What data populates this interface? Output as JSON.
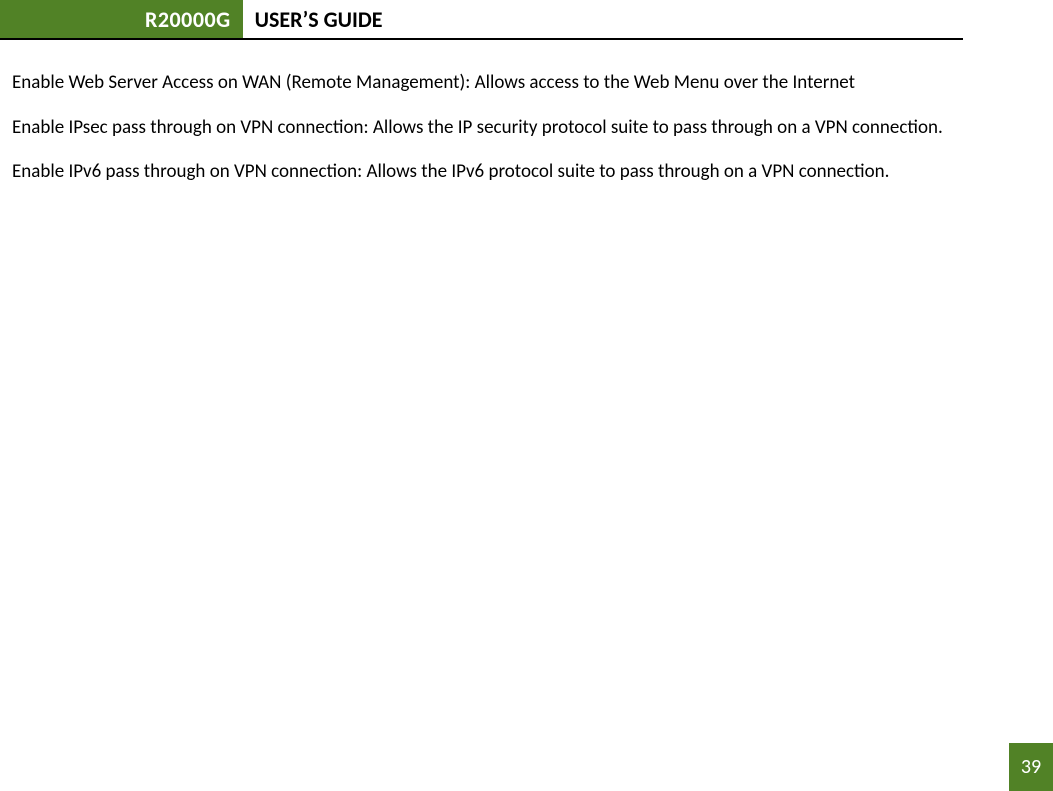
{
  "header": {
    "badge": "R20000G",
    "title": "USER’S GUIDE"
  },
  "content": {
    "paragraphs": [
      "Enable Web Server Access on WAN (Remote Management): Allows access to the Web Menu over the Internet",
      "Enable IPsec pass through on VPN connection: Allows the IP security protocol suite to pass through on a VPN connection.",
      "Enable IPv6 pass through on VPN connection: Allows the IPv6 protocol suite to pass through on a VPN connection."
    ]
  },
  "page_number": "39"
}
